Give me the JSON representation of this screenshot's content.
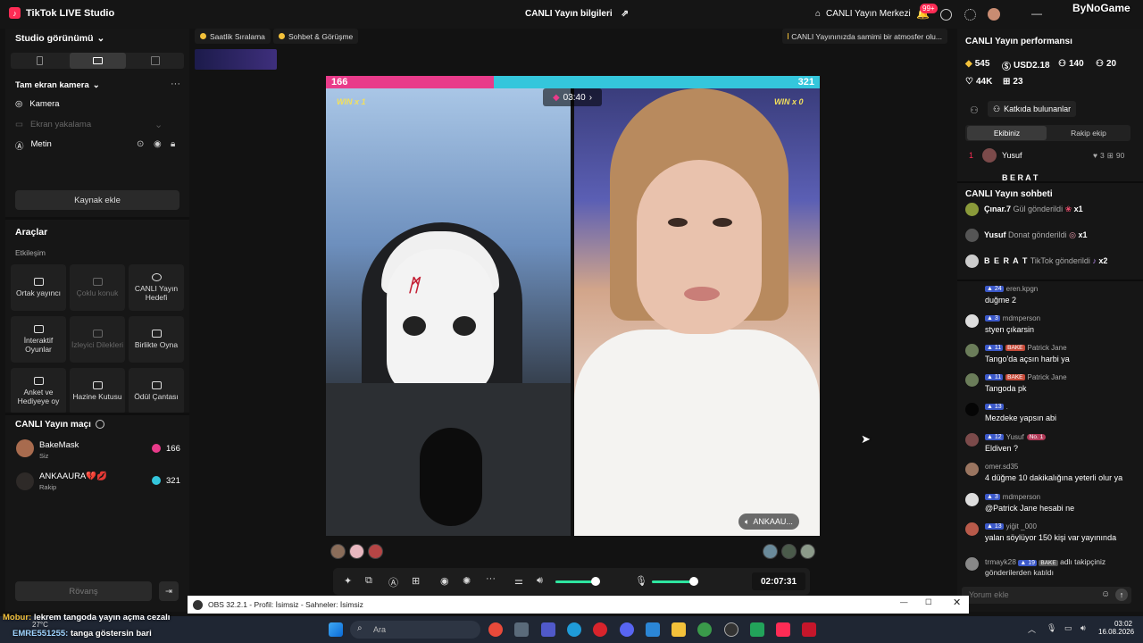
{
  "window": {
    "app_title": "TikTok LIVE Studio",
    "center_title": "CANLI Yayın bilgileri",
    "center_link": "CANLI Yayın Merkezi",
    "notif_count": "99+",
    "watermark": "ByNoGame"
  },
  "left": {
    "studio_view": "Studio görünümü",
    "source_group": "Tam ekran kamera",
    "sources": [
      "Kamera",
      "Ekran yakalama",
      "Metin"
    ],
    "add_source": "Kaynak ekle",
    "tools_title": "Araçlar",
    "engagement_label": "Etkileşim",
    "tools": [
      {
        "label": "Ortak yayıncı",
        "enabled": true
      },
      {
        "label": "Çoklu konuk",
        "enabled": false
      },
      {
        "label": "CANLI Yayın Hedefi",
        "enabled": true
      },
      {
        "label": "İnteraktif Oyunlar",
        "enabled": true
      },
      {
        "label": "İzleyici Dilekleri",
        "enabled": false
      },
      {
        "label": "Birlikte Oyna",
        "enabled": true
      },
      {
        "label": "Anket ve Hediyeye oy",
        "enabled": true
      },
      {
        "label": "Hazine Kutusu",
        "enabled": true
      },
      {
        "label": "Ödül Çantası",
        "enabled": true
      }
    ],
    "match_title": "CANLI Yayın maçı",
    "players": [
      {
        "name": "BakeMask",
        "role": "Siz",
        "score": "166"
      },
      {
        "name": "ANKAAURA💔💋",
        "role": "Rakip",
        "score": "321"
      }
    ],
    "rematch": "Rövanş"
  },
  "top_chips": [
    "Saatlik Sıralama",
    "Sohbet & Görüşme"
  ],
  "tip": "CANLI Yayınınızda samimi bir atmosfer olu...",
  "battle": {
    "score_left": "166",
    "score_right": "321",
    "win_left": "WIN x 1",
    "win_right": "WIN x 0",
    "timer": "03:40",
    "opponent_tag": "ANKAAU...",
    "left_share": 0.34
  },
  "controls": {
    "elapsed": "02:07:31",
    "volume": 0.8,
    "mic": 0.5
  },
  "right": {
    "perf_title": "CANLI Yayın performansı",
    "stats": [
      "545",
      "USD2.18",
      "140",
      "20",
      "44K",
      "23"
    ],
    "contributors": "Katkıda bulunanlar",
    "tab_own": "Ekibiniz",
    "tab_rival": "Rakip ekip",
    "top_rank": {
      "rank": "1",
      "name": "Yusuf",
      "hearts": "3",
      "gifts": "90"
    },
    "second_name": "B E R A T",
    "chat_title": "CANLI Yayın sohbeti",
    "gifts": [
      {
        "name": "Çınar.7",
        "action": "Gül gönderildi",
        "count": "x1"
      },
      {
        "name": "Yusuf",
        "action": "Donat gönderildi",
        "count": "x1"
      },
      {
        "name": "B E R A T",
        "action": "TikTok gönderildi",
        "count": "x2"
      }
    ],
    "messages": [
      {
        "level": "24",
        "user": "eren.kpgn",
        "text": "duğme 2"
      },
      {
        "level": "3",
        "user": "mdmperson",
        "text": "styen çıkarsin"
      },
      {
        "level": "11",
        "user": "Patrick Jane",
        "bake": "BAKE",
        "text": "Tango'da açsın harbi ya"
      },
      {
        "level": "11",
        "user": "Patrick Jane",
        "bake": "BAKE",
        "text": "Tangoda pk"
      },
      {
        "level": "13",
        "user": ".",
        "text": "Mezdeke yapsın abi"
      },
      {
        "level": "12",
        "user": "Yusuf",
        "no1": "No. 1",
        "text": "Eldiven ?"
      },
      {
        "level": "",
        "user": "omer.sd35",
        "text": "4 düğme 10 dakikalığına yeterli olur ya"
      },
      {
        "level": "3",
        "user": "mdmperson",
        "text": "@Patrick Jane hesabi ne"
      },
      {
        "level": "13",
        "user": "yiğit _000",
        "text": "yalan söylüyor 150 kişi var yayınında"
      }
    ],
    "follow_user": "trmayk28",
    "follow_level": "19",
    "follow_text_1": "adlı takipçiniz",
    "follow_text_2": "gönderilerden katıldı",
    "comment_placeholder": "Yorum ekle"
  },
  "obs": {
    "title": "OBS 32.2.1 - Profil: İsimsiz - Sahneler: İsimsiz"
  },
  "overlay": {
    "line1_user": "Mobur:",
    "line1_text": "lekrem tangoda yayın açma cezalı",
    "line2_user": "EMRE551255:",
    "line2_text": "tanga göstersin bari"
  },
  "taskbar": {
    "temp": "27°C",
    "search": "Ara",
    "time": "03:02",
    "date": "16.08.2026"
  }
}
